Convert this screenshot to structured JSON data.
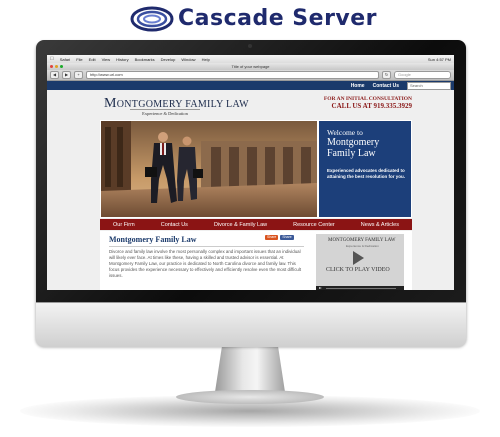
{
  "brand": {
    "name": "Cascade Server",
    "logo_icon": "swirl-logo-icon"
  },
  "mac_menu": {
    "items": [
      "Safari",
      "File",
      "Edit",
      "View",
      "History",
      "Bookmarks",
      "Develop",
      "Window",
      "Help"
    ],
    "clock": "Sun 4:57 PM"
  },
  "browser": {
    "window_title": "Title of your webpage",
    "url": "http://www.url.com",
    "search_placeholder": "Google"
  },
  "site": {
    "topnav": {
      "home": "Home",
      "contact": "Contact Us",
      "search_placeholder": "Search"
    },
    "logo_first": "M",
    "logo_rest": "ONTGOMERY FAMILY LAW",
    "tagline": "Experience & Dedication",
    "consult_line1": "FOR AN INITIAL CONSULTATION",
    "consult_line2": "CALL US AT 919.335.3929",
    "hero": {
      "welcome": "Welcome to",
      "firm": "Montgomery Family Law",
      "blurb": "Experienced advocates dedicated to attaining the best resolution for you."
    },
    "mainnav": [
      "Our Firm",
      "Contact Us",
      "Divorce & Family Law",
      "Resource Center",
      "News & Articles"
    ],
    "content": {
      "heading": "Montgomery Family Law",
      "share": [
        "Share",
        "Share"
      ],
      "paragraph": "Divorce and family law involve the most personally complex and important issues that an individual will likely ever face. At times like these, having a skilled and trusted advisor is essential. At Montgomery Family Law, our practice is dedicated to North Carolina divorce and family law. This focus provides the experience necessary to effectively and efficiently resolve even the most difficult issues."
    },
    "video": {
      "logo": "MONTGOMERY FAMILY LAW",
      "sublogo": "Experience & Dedication",
      "cta": "CLICK TO PLAY VIDEO"
    }
  },
  "colors": {
    "brand_navy": "#1f2a6d",
    "nav_blue": "#1b3a6b",
    "nav_red": "#8b1414",
    "panel_blue": "#1c3f7a",
    "consult_red": "#8b1a1a"
  }
}
